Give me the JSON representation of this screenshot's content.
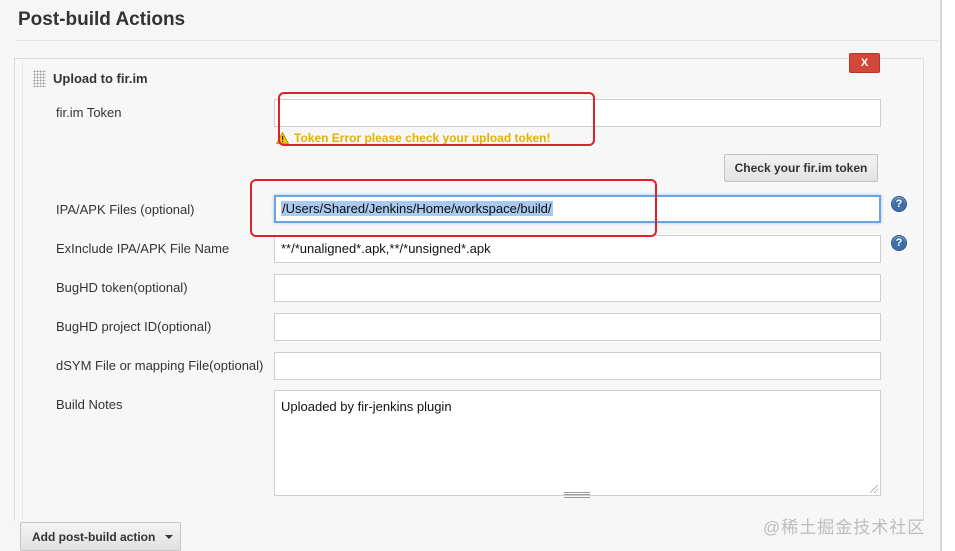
{
  "section": {
    "title": "Post-build Actions"
  },
  "plugin": {
    "title": "Upload to fir.im",
    "delete_label": "X"
  },
  "token": {
    "label": "fir.im Token",
    "value": "",
    "warning": "Token Error please check your upload token!",
    "check_button": "Check your fir.im token"
  },
  "fields": {
    "ipa_label": "IPA/APK Files (optional)",
    "ipa_value": "/Users/Shared/Jenkins/Home/workspace/build/",
    "exclude_label": "ExInclude IPA/APK File Name",
    "exclude_value": "**/*unaligned*.apk,**/*unsigned*.apk",
    "bughd_token_label": "BugHD token(optional)",
    "bughd_token_value": "",
    "bughd_project_label": "BugHD project ID(optional)",
    "bughd_project_value": "",
    "dsym_label": "dSYM File or mapping File(optional)",
    "dsym_value": "",
    "notes_label": "Build Notes",
    "notes_value": "Uploaded by fir-jenkins plugin"
  },
  "help_icon_glyph": "?",
  "add_action": {
    "label": "Add post-build action"
  },
  "watermark": "@稀土掘金技术社区",
  "colors": {
    "annotation": "#e0202d",
    "delete": "#d24939",
    "warning": "#e3b200",
    "help": "#3e6fa8",
    "selection": "#a9c9ee"
  }
}
